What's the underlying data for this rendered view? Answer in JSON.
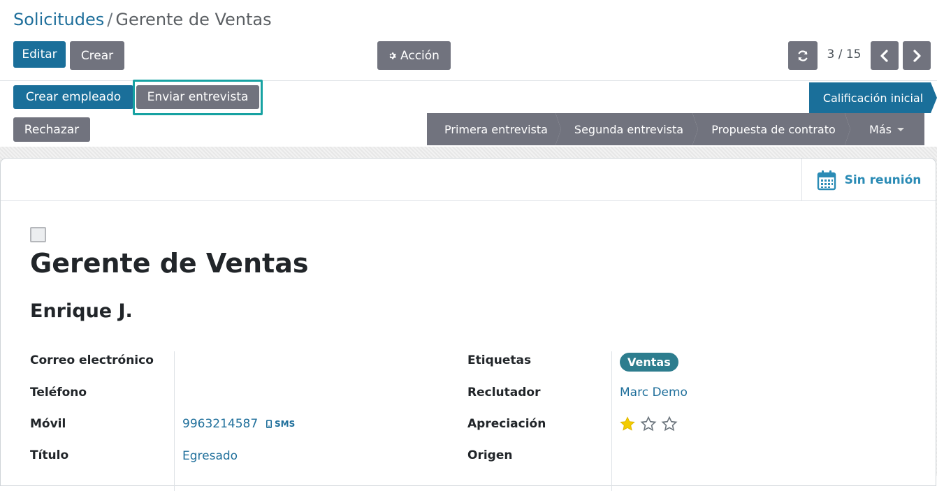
{
  "breadcrumb": {
    "parent": "Solicitudes",
    "separator": "/",
    "current": "Gerente de Ventas"
  },
  "toolbar": {
    "edit_label": "Editar",
    "create_label": "Crear",
    "action_label": "Acción",
    "action_icon": "gear-icon",
    "reload_icon": "refresh-icon"
  },
  "pager": {
    "value": "3 / 15",
    "prev_icon": "chevron-left-icon",
    "next_icon": "chevron-right-icon"
  },
  "header_buttons": {
    "create_employee": "Crear empleado",
    "send_interview": "Enviar entrevista",
    "refuse": "Rechazar"
  },
  "stages": {
    "current": "Calificación inicial",
    "items": [
      "Primera entrevista",
      "Segunda entrevista",
      "Propuesta de contrato"
    ],
    "more_label": "Más"
  },
  "smart_buttons": {
    "meeting_label": "Sin reunión",
    "meeting_icon": "calendar-icon"
  },
  "form": {
    "job_title": "Gerente de Ventas",
    "partner_name": "Enrique J.",
    "labels": {
      "email": "Correo electrónico",
      "phone": "Teléfono",
      "mobile": "Móvil",
      "degree": "Título",
      "tags": "Etiquetas",
      "recruiter": "Reclutador",
      "priority": "Apreciación",
      "source": "Origen"
    },
    "values": {
      "email": "",
      "phone": "",
      "mobile": "9963214587",
      "sms_label": "SMS",
      "degree": "Egresado",
      "tag": "Ventas",
      "recruiter": "Marc Demo",
      "priority_stars": 1,
      "priority_max": 3,
      "source": ""
    }
  },
  "colors": {
    "primary": "#1a6f9a",
    "secondary": "#71737e",
    "link": "#1f6f9b",
    "tag": "#2d7d8e",
    "highlight": "#17a2a2",
    "star": "#f3cc00"
  }
}
